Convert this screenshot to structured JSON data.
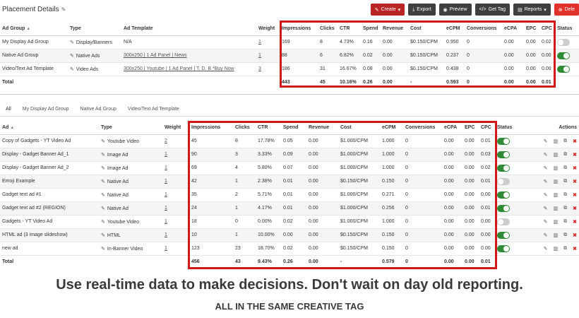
{
  "header": {
    "title": "Placement Details",
    "buttons": {
      "create": "Create",
      "export": "Export",
      "preview": "Preview",
      "get_tag": "Get Tag",
      "reports": "Reports",
      "delete": "Dele"
    }
  },
  "placements": {
    "columns": [
      "Ad Group",
      "Type",
      "Ad Template",
      "Weight",
      "Impressions",
      "Clicks",
      "CTR",
      "Spend",
      "Revenue",
      "Cost",
      "eCPM",
      "Conversions",
      "eCPA",
      "EPC",
      "CPC",
      "Status"
    ],
    "rows": [
      {
        "name": "My Display Ad Group",
        "type": "Display/Banners",
        "template": "N/A",
        "template_link": false,
        "weight": "1",
        "impressions": "169",
        "clicks": "8",
        "ctr": "4.73%",
        "spend": "0.16",
        "revenue": "0.00",
        "cost": "$0.150/CPM",
        "ecpm": "0.950",
        "conversions": "0",
        "ecpa": "0.00",
        "epc": "0.00",
        "cpc": "0.02",
        "status": "off"
      },
      {
        "name": "Native Ad Group",
        "type": "Native Ads",
        "template": "300x250 | 1 Ad Panel | News",
        "template_link": true,
        "weight": "1",
        "impressions": "88",
        "clicks": "6",
        "ctr": "6.82%",
        "spend": "0.02",
        "revenue": "0.00",
        "cost": "$0.150/CPM",
        "ecpm": "0.237",
        "conversions": "0",
        "ecpa": "0.00",
        "epc": "0.00",
        "cpc": "0.00",
        "status": "on"
      },
      {
        "name": "Video/Text Ad Template",
        "type": "Video Ads",
        "template": "300x250 | Youtube | 1 Ad Panel | T. D. B *Buy Now",
        "template_link": true,
        "weight": "3",
        "impressions": "186",
        "clicks": "31",
        "ctr": "16.67%",
        "spend": "0.08",
        "revenue": "0.00",
        "cost": "$0.150/CPM",
        "ecpm": "0.438",
        "conversions": "0",
        "ecpa": "0.00",
        "epc": "0.00",
        "cpc": "0.00",
        "status": "on"
      }
    ],
    "total": {
      "label": "Total",
      "impressions": "443",
      "clicks": "45",
      "ctr": "10.16%",
      "spend": "0.26",
      "revenue": "0.00",
      "cost": "-",
      "ecpm": "0.593",
      "conversions": "0",
      "ecpa": "0.00",
      "epc": "0.00",
      "cpc": "0.01"
    }
  },
  "tabs": [
    "All",
    "My Display Ad Group",
    "Native Ad Group",
    "Video/Text Ad Template"
  ],
  "ads": {
    "columns": [
      "Ad",
      "Type",
      "Weight",
      "Impressions",
      "Clicks",
      "CTR",
      "Spend",
      "Revenue",
      "Cost",
      "eCPM",
      "Conversions",
      "eCPA",
      "EPC",
      "CPC",
      "Status",
      "Actions"
    ],
    "rows": [
      {
        "name": "Copy of Gadgets - YT Video Ad",
        "type": "Youtube Video",
        "weight": "2",
        "impressions": "45",
        "clicks": "8",
        "ctr": "17.78%",
        "spend": "0.05",
        "revenue": "0.00",
        "cost": "$1.000/CPM",
        "ecpm": "1.000",
        "conversions": "0",
        "ecpa": "0.00",
        "epc": "0.00",
        "cpc": "0.01",
        "status": "on"
      },
      {
        "name": "Display - Gadget Banner Ad_1",
        "type": "Image Ad",
        "weight": "1",
        "impressions": "90",
        "clicks": "3",
        "ctr": "3.33%",
        "spend": "0.09",
        "revenue": "0.00",
        "cost": "$1.000/CPM",
        "ecpm": "1.000",
        "conversions": "0",
        "ecpa": "0.00",
        "epc": "0.00",
        "cpc": "0.03",
        "status": "on"
      },
      {
        "name": "Display - Gadget Banner Ad_2",
        "type": "Image Ad",
        "weight": "1",
        "impressions": "69",
        "clicks": "4",
        "ctr": "5.80%",
        "spend": "0.07",
        "revenue": "0.00",
        "cost": "$1.000/CPM",
        "ecpm": "1.000",
        "conversions": "0",
        "ecpa": "0.00",
        "epc": "0.00",
        "cpc": "0.02",
        "status": "on"
      },
      {
        "name": "Emoji Example",
        "type": "Native Ad",
        "weight": "1",
        "impressions": "42",
        "clicks": "1",
        "ctr": "2.38%",
        "spend": "0.01",
        "revenue": "0.00",
        "cost": "$0.150/CPM",
        "ecpm": "0.150",
        "conversions": "0",
        "ecpa": "0.00",
        "epc": "0.00",
        "cpc": "0.01",
        "status": "off"
      },
      {
        "name": "Gadget text ad #1",
        "type": "Native Ad",
        "weight": "1",
        "impressions": "35",
        "clicks": "2",
        "ctr": "5.71%",
        "spend": "0.01",
        "revenue": "0.00",
        "cost": "$1.000/CPM",
        "ecpm": "0.271",
        "conversions": "0",
        "ecpa": "0.00",
        "epc": "0.00",
        "cpc": "0.00",
        "status": "on"
      },
      {
        "name": "Gadget text ad #2 (REGION)",
        "type": "Native Ad",
        "weight": "1",
        "impressions": "24",
        "clicks": "1",
        "ctr": "4.17%",
        "spend": "0.01",
        "revenue": "0.00",
        "cost": "$1.000/CPM",
        "ecpm": "0.256",
        "conversions": "0",
        "ecpa": "0.00",
        "epc": "0.00",
        "cpc": "0.01",
        "status": "on"
      },
      {
        "name": "Gadgets - YT Video Ad",
        "type": "Youtube Video",
        "weight": "1",
        "impressions": "18",
        "clicks": "0",
        "ctr": "0.00%",
        "spend": "0.02",
        "revenue": "0.00",
        "cost": "$1.000/CPM",
        "ecpm": "1.000",
        "conversions": "0",
        "ecpa": "0.00",
        "epc": "0.00",
        "cpc": "0.00",
        "status": "off"
      },
      {
        "name": "HTML ad (3 image slideshow)",
        "type": "HTML",
        "weight": "1",
        "impressions": "10",
        "clicks": "1",
        "ctr": "10.00%",
        "spend": "0.00",
        "revenue": "0.00",
        "cost": "$0.150/CPM",
        "ecpm": "0.150",
        "conversions": "0",
        "ecpa": "0.00",
        "epc": "0.00",
        "cpc": "0.00",
        "status": "on"
      },
      {
        "name": "new ad",
        "type": "In-Banner Video",
        "weight": "1",
        "impressions": "123",
        "clicks": "23",
        "ctr": "18.70%",
        "spend": "0.02",
        "revenue": "0.00",
        "cost": "$0.150/CPM",
        "ecpm": "0.150",
        "conversions": "0",
        "ecpa": "0.00",
        "epc": "0.00",
        "cpc": "0.00",
        "status": "on"
      }
    ],
    "total": {
      "label": "Total",
      "impressions": "456",
      "clicks": "43",
      "ctr": "9.43%",
      "spend": "0.26",
      "revenue": "0.00",
      "cost": "-",
      "ecpm": "0.579",
      "conversions": "0",
      "ecpa": "0.00",
      "epc": "0.00",
      "cpc": "0.01"
    }
  },
  "caption": {
    "line1": "Use real-time data to make decisions. Don't wait on day old reporting.",
    "line2": "ALL IN THE SAME CREATIVE TAG"
  },
  "colors": {
    "highlight": "#d01818",
    "toggle_on": "#2e8a34",
    "create_button": "#b92424"
  }
}
